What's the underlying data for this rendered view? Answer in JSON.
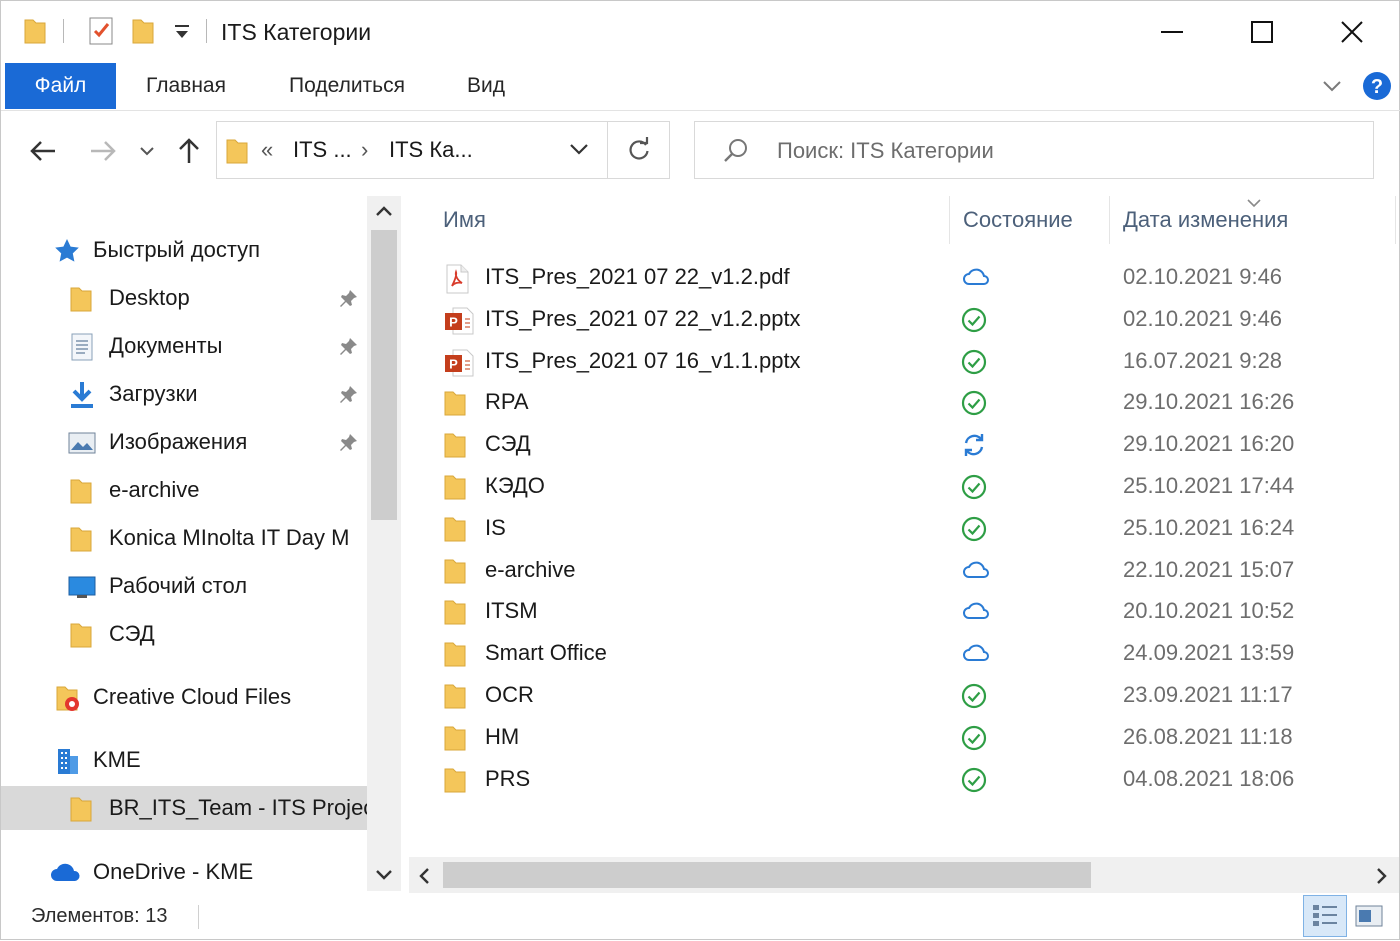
{
  "window": {
    "title": "ITS Категории"
  },
  "ribbon": {
    "tabs": [
      "Файл",
      "Главная",
      "Поделиться",
      "Вид"
    ]
  },
  "address": {
    "crumb1": "ITS ...",
    "crumb2": "ITS Ка...",
    "prefix": "«",
    "separator": "›"
  },
  "search": {
    "placeholder": "Поиск: ITS Категории"
  },
  "nav": {
    "quick_access": "Быстрый доступ",
    "items": [
      {
        "label": "Desktop",
        "icon": "folder-icon",
        "pinned": true
      },
      {
        "label": "Документы",
        "icon": "documents-icon",
        "pinned": true
      },
      {
        "label": "Загрузки",
        "icon": "downloads-icon",
        "pinned": true
      },
      {
        "label": "Изображения",
        "icon": "pictures-icon",
        "pinned": true
      },
      {
        "label": "e-archive",
        "icon": "folder-icon",
        "pinned": false
      },
      {
        "label": "Konica MInolta IT Day M",
        "icon": "folder-icon",
        "pinned": false
      },
      {
        "label": "Рабочий стол",
        "icon": "desktop-icon",
        "pinned": false
      },
      {
        "label": "СЭД",
        "icon": "folder-icon",
        "pinned": false
      }
    ],
    "creative_cloud": "Creative Cloud Files",
    "kme": "KME",
    "team": "BR_ITS_Team - ITS Projec",
    "onedrive": "OneDrive - KME"
  },
  "columns": {
    "name": "Имя",
    "status": "Состояние",
    "date": "Дата изменения"
  },
  "files": [
    {
      "name": "ITS_Pres_2021 07 22_v1.2.pdf",
      "type": "pdf",
      "status": "cloud",
      "date": "02.10.2021 9:46"
    },
    {
      "name": "ITS_Pres_2021 07 22_v1.2.pptx",
      "type": "pptx",
      "status": "synced",
      "date": "02.10.2021 9:46"
    },
    {
      "name": "ITS_Pres_2021 07 16_v1.1.pptx",
      "type": "pptx",
      "status": "synced",
      "date": "16.07.2021 9:28"
    },
    {
      "name": "RPA",
      "type": "folder",
      "status": "synced",
      "date": "29.10.2021 16:26"
    },
    {
      "name": "СЭД",
      "type": "folder",
      "status": "syncing",
      "date": "29.10.2021 16:20"
    },
    {
      "name": "КЭДО",
      "type": "folder",
      "status": "synced",
      "date": "25.10.2021 17:44"
    },
    {
      "name": "IS",
      "type": "folder",
      "status": "synced",
      "date": "25.10.2021 16:24"
    },
    {
      "name": "e-archive",
      "type": "folder",
      "status": "cloud",
      "date": "22.10.2021 15:07"
    },
    {
      "name": "ITSM",
      "type": "folder",
      "status": "cloud",
      "date": "20.10.2021 10:52"
    },
    {
      "name": "Smart Office",
      "type": "folder",
      "status": "cloud",
      "date": "24.09.2021 13:59"
    },
    {
      "name": "OCR",
      "type": "folder",
      "status": "synced",
      "date": "23.09.2021 11:17"
    },
    {
      "name": "HM",
      "type": "folder",
      "status": "synced",
      "date": "26.08.2021 11:18"
    },
    {
      "name": "PRS",
      "type": "folder",
      "status": "synced",
      "date": "04.08.2021 18:06"
    }
  ],
  "statusbar": {
    "items": "Элементов: 13"
  },
  "colors": {
    "accent": "#1a6ad6",
    "folder": "#f4c65a",
    "synced": "#2e9e45",
    "cloud": "#2a7bd4"
  }
}
